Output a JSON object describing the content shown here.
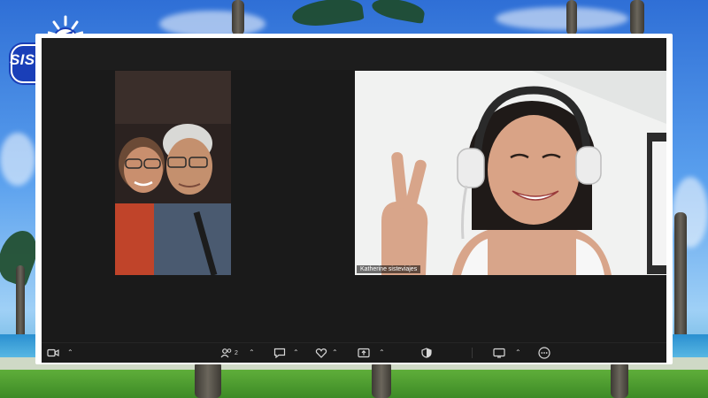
{
  "brand": {
    "logo_text": "SISTE VIAJES"
  },
  "meeting": {
    "participants": [
      {
        "name": ""
      },
      {
        "name": "Katherine sisteviajes"
      }
    ],
    "toolbar": {
      "participant_count": "2",
      "icons": [
        "video-camera-icon",
        "participants-icon",
        "chat-icon",
        "reactions-icon",
        "share-screen-icon",
        "security-icon",
        "view-icon",
        "more-icon"
      ]
    }
  },
  "colors": {
    "brand_blue": "#1a3fb8",
    "meeting_bg": "#1a1a1a",
    "frame": "#ffffff"
  }
}
